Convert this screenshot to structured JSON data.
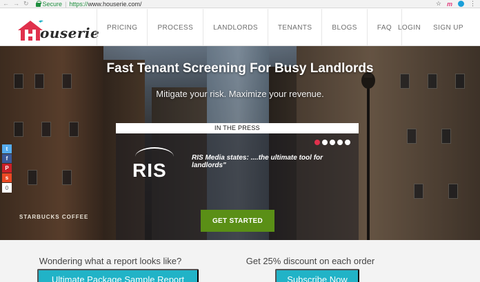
{
  "browser": {
    "secure_label": "Secure",
    "separator": "|",
    "url_scheme": "https://",
    "url_host": "www.houserie.com",
    "url_path": "/",
    "extension_label": "m"
  },
  "header": {
    "logo_text": "ouserie",
    "nav": [
      "PRICING",
      "PROCESS",
      "LANDLORDS",
      "TENANTS",
      "BLOGS",
      "FAQ"
    ],
    "login": "LOGIN",
    "signup": "SIGN UP"
  },
  "hero": {
    "title": "Fast Tenant Screening For Busy Landlords",
    "subtitle": "Mitigate your risk. Maximize your revenue.",
    "store_sign": "STARBUCKS COFFEE",
    "press_heading": "IN THE PRESS",
    "press_logo": "RIS",
    "press_quote": "RIS Media states: ....the ultimate tool for landlords\"",
    "carousel_total": 5,
    "carousel_active_index": 0,
    "cta_label": "GET STARTED"
  },
  "social": {
    "share_count": "0",
    "icons": [
      "twitter-icon",
      "facebook-icon",
      "pinterest-icon",
      "stumbleupon-icon"
    ]
  },
  "bottom": {
    "left_heading": "Wondering what a report looks like?",
    "left_button": "Ultimate Package Sample Report",
    "right_heading": "Get 25% discount on each order",
    "right_button": "Subscribe Now"
  },
  "colors": {
    "cta_green": "#5a8f16",
    "teal_button": "#21b3c7",
    "logo_red": "#e0314c",
    "carousel_active": "#e0314c"
  }
}
